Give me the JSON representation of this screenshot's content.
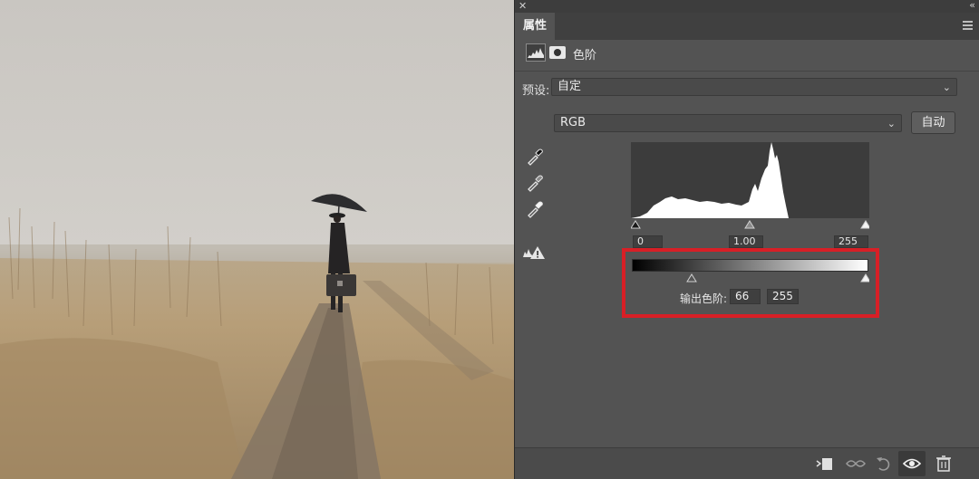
{
  "panel": {
    "tab_label": "属性",
    "adjustment_title": "色阶",
    "preset_label": "预设:",
    "preset_value": "自定",
    "channel_value": "RGB",
    "auto_label": "自动",
    "input_levels": {
      "black": "0",
      "gamma": "1.00",
      "white": "255"
    },
    "output_label": "输出色阶:",
    "output_levels": {
      "black": "66",
      "white": "255"
    }
  },
  "icons": {
    "close": "close-icon",
    "collapse": "double-chevron-icon",
    "menu": "panel-menu-icon",
    "levels": "levels-histogram-icon",
    "mask": "layer-mask-icon",
    "eyedroppers": [
      "black-point-eyedropper-icon",
      "gray-point-eyedropper-icon",
      "white-point-eyedropper-icon"
    ],
    "warning": "clipping-warning-icon",
    "bottom": [
      "clip-to-layer-icon",
      "view-previous-state-icon",
      "reset-icon",
      "visibility-eye-icon",
      "trash-icon"
    ]
  },
  "colors": {
    "panel_bg": "#535353",
    "highlight_border": "#d81f26"
  }
}
